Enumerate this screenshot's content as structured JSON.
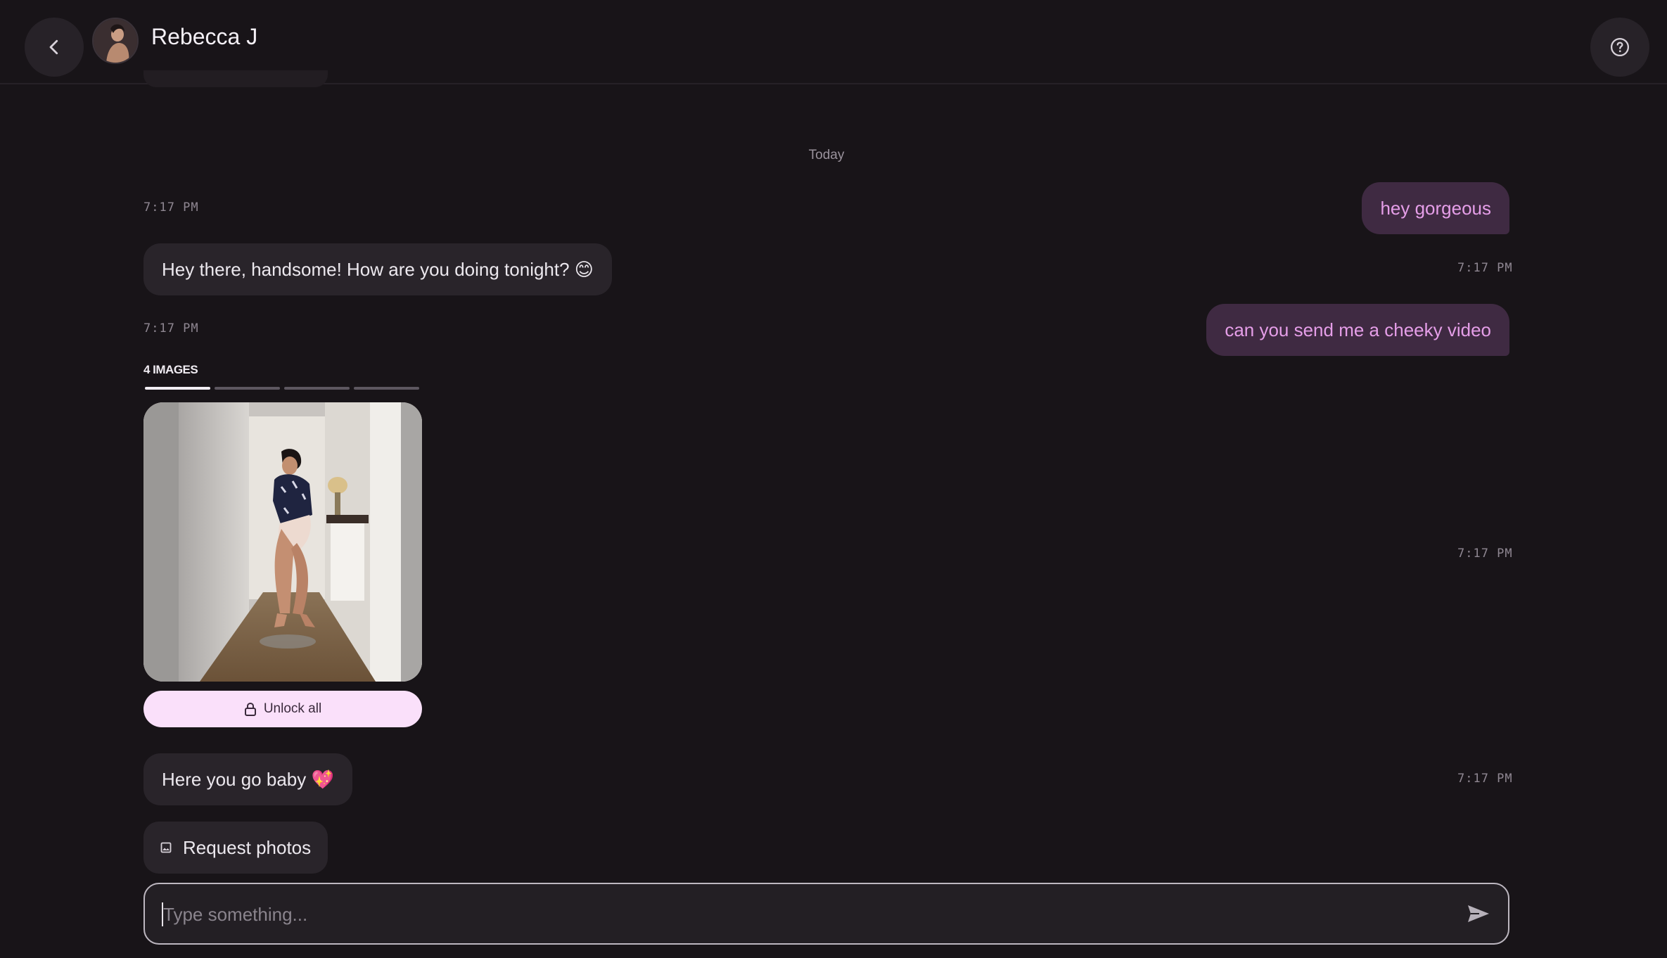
{
  "header": {
    "contact_name": "Rebecca J",
    "back_icon": "chevron-left-icon",
    "help_icon": "help-circle-icon"
  },
  "date_divider": "Today",
  "messages": [
    {
      "direction": "incoming",
      "time": "7:17 PM"
    },
    {
      "direction": "outgoing",
      "text": "hey gorgeous"
    },
    {
      "direction": "incoming",
      "text": "Hey there, handsome! How are you doing tonight? 😊"
    },
    {
      "direction": "outgoing",
      "time": "7:17 PM"
    },
    {
      "direction": "incoming",
      "time": "7:17 PM"
    },
    {
      "direction": "outgoing",
      "text": "can you send me a cheeky video"
    },
    {
      "direction": "outgoing",
      "time": "7:17 PM"
    },
    {
      "direction": "incoming",
      "text": "Here you go baby 💖"
    },
    {
      "direction": "outgoing",
      "time": "7:17 PM"
    }
  ],
  "media": {
    "label": "4 IMAGES",
    "image_count": 4,
    "current_index": 1,
    "unlock_label": "Unlock all",
    "lock_icon": "lock-icon"
  },
  "actions": {
    "request_photos_label": "Request photos",
    "image_icon": "image-icon"
  },
  "composer": {
    "placeholder": "Type something...",
    "value": "",
    "send_icon": "send-icon"
  },
  "colors": {
    "background": "#181418",
    "incoming_bubble": "#29242a",
    "outgoing_bubble": "#3f2a42",
    "outgoing_text": "#e59ee8",
    "unlock_button": "#fae0fa"
  }
}
